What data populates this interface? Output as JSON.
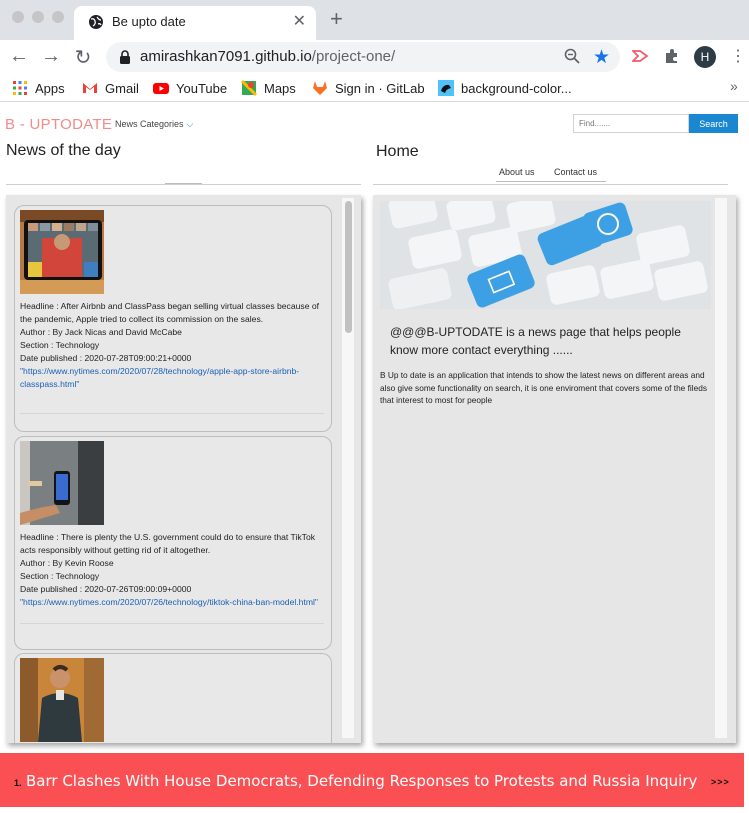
{
  "browser": {
    "tab_title": "Be upto date",
    "tab_close": "✕",
    "new_tab": "+",
    "url_host": "amirashkan7091.github.io",
    "url_path": "/project-one/",
    "profile_initial": "H",
    "bookmarks": [
      {
        "label": "Apps",
        "icon": "apps-grid-icon"
      },
      {
        "label": "Gmail",
        "icon": "gmail-icon"
      },
      {
        "label": "YouTube",
        "icon": "youtube-icon"
      },
      {
        "label": "Maps",
        "icon": "maps-icon"
      },
      {
        "label": "Sign in · GitLab",
        "icon": "gitlab-icon"
      },
      {
        "label": "background-color...",
        "icon": "bookmark-favicon-icon"
      }
    ],
    "bookmarks_more": "»"
  },
  "site": {
    "brand": "B - UPTODATE",
    "categories_label": "News Categories",
    "search_placeholder": "Find.......",
    "search_button": "Search",
    "left_title": "News of the day",
    "right_title": "Home",
    "nav": [
      "About us",
      "Contact us"
    ]
  },
  "news": [
    {
      "headline": "Headline : After Airbnb and ClassPass began selling virtual classes because of the pandemic, Apple tried to collect its commission on the sales.",
      "author": "Author : By Jack Nicas and David McCabe",
      "section": "Section : Technology",
      "date": "Date published : 2020-07-28T09:00:21+0000",
      "link": "\"https://www.nytimes.com/2020/07/28/technology/apple-app-store-airbnb-classpass.html\""
    },
    {
      "headline": "Headline : There is plenty the U.S. government could do to ensure that TikTok acts responsibly without getting rid of it altogether.",
      "author": "Author : By Kevin Roose",
      "section": "Section : Technology",
      "date": "Date published : 2020-07-26T09:00:09+0000",
      "link": "\"https://www.nytimes.com/2020/07/26/technology/tiktok-china-ban-model.html\""
    }
  ],
  "home": {
    "tagline": "@@@B-UPTODATE is a news page that helps people know more contact everything ......",
    "about": "B Up to date is an application that intends to show the latest news on different areas and also give some functionality on search, it is one enviroment that covers some of the fileds that interest to most for people"
  },
  "ticker": {
    "number": "1.",
    "headline": "Barr Clashes With House Democrats, Defending Responses to Protests and Russia Inquiry",
    "more": ">>>"
  },
  "colors": {
    "brand": "#f28b8b",
    "search_button": "#1b87d0",
    "ticker_bg": "#fa4f53",
    "link": "#1a5fb4"
  }
}
